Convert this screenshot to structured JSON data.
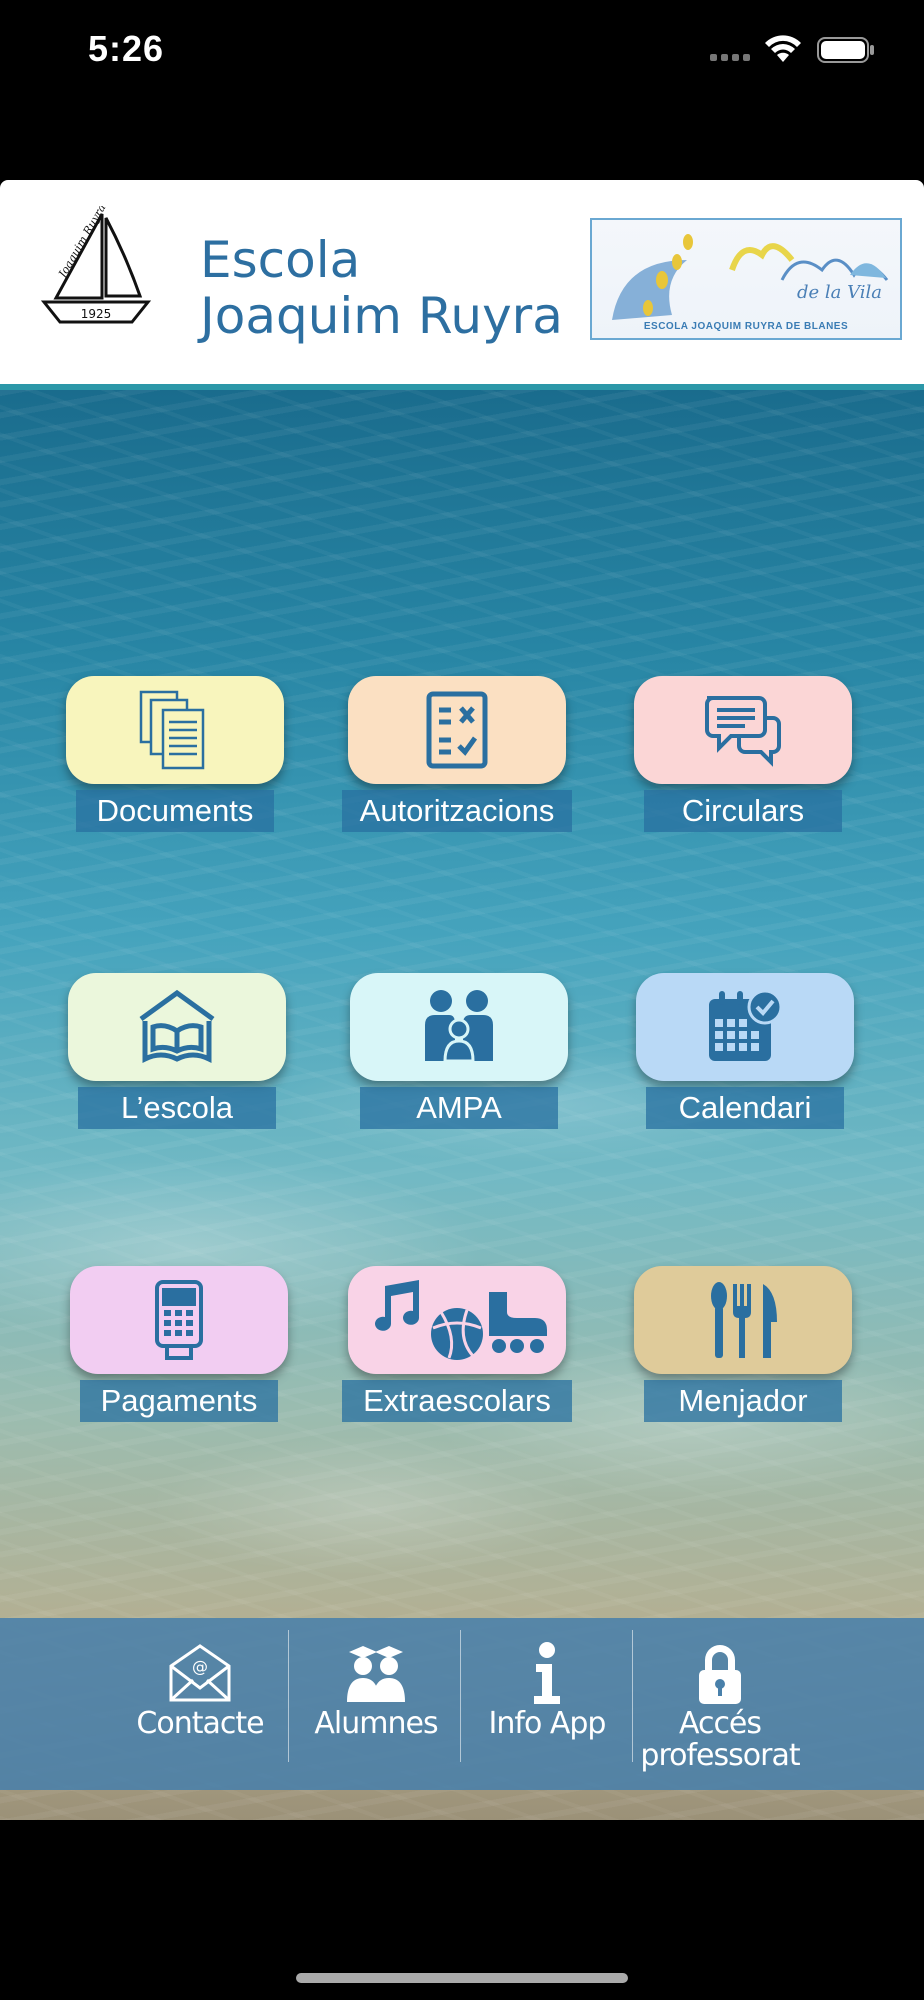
{
  "status_bar": {
    "time": "5:26"
  },
  "header": {
    "title_line1": "Escola",
    "title_line2": "Joaquim Ruyra",
    "logo_text": "Joaquim Ruyra",
    "logo_year": "1925",
    "banner_script": "de la Vila",
    "banner_caption": "ESCOLA JOAQUIM RUYRA DE BLANES"
  },
  "tiles": [
    {
      "label": "Documents",
      "icon": "documents-icon",
      "color": "#f8f5bd"
    },
    {
      "label": "Autoritzacions",
      "icon": "checklist-icon",
      "color": "#fbe0c2"
    },
    {
      "label": "Circulars",
      "icon": "chat-bubbles-icon",
      "color": "#fbd6d6"
    },
    {
      "label": "L’escola",
      "icon": "open-book-icon",
      "color": "#ebf7dc"
    },
    {
      "label": "AMPA",
      "icon": "family-icon",
      "color": "#d8f6f8"
    },
    {
      "label": "Calendari",
      "icon": "calendar-icon",
      "color": "#b9d9f6"
    },
    {
      "label": "Pagaments",
      "icon": "payment-terminal-icon",
      "color": "#f2cdf2"
    },
    {
      "label": "Extraescolars",
      "icon": "activities-icon",
      "color": "#f9d3e7"
    },
    {
      "label": "Menjador",
      "icon": "cutlery-icon",
      "color": "#dfcb9a"
    }
  ],
  "bottom_bar": [
    {
      "label": "Contacte",
      "icon": "envelope-icon"
    },
    {
      "label": "Alumnes",
      "icon": "students-icon"
    },
    {
      "label": "Info App",
      "icon": "info-icon"
    },
    {
      "label_line1": "Accés",
      "label_line2": "professorat",
      "icon": "lock-icon"
    }
  ],
  "colors": {
    "accent": "#2d6fa1",
    "icon": "#2a6fa0",
    "header_line": "#2b97a8",
    "bottom_bar": "#4980aa"
  }
}
